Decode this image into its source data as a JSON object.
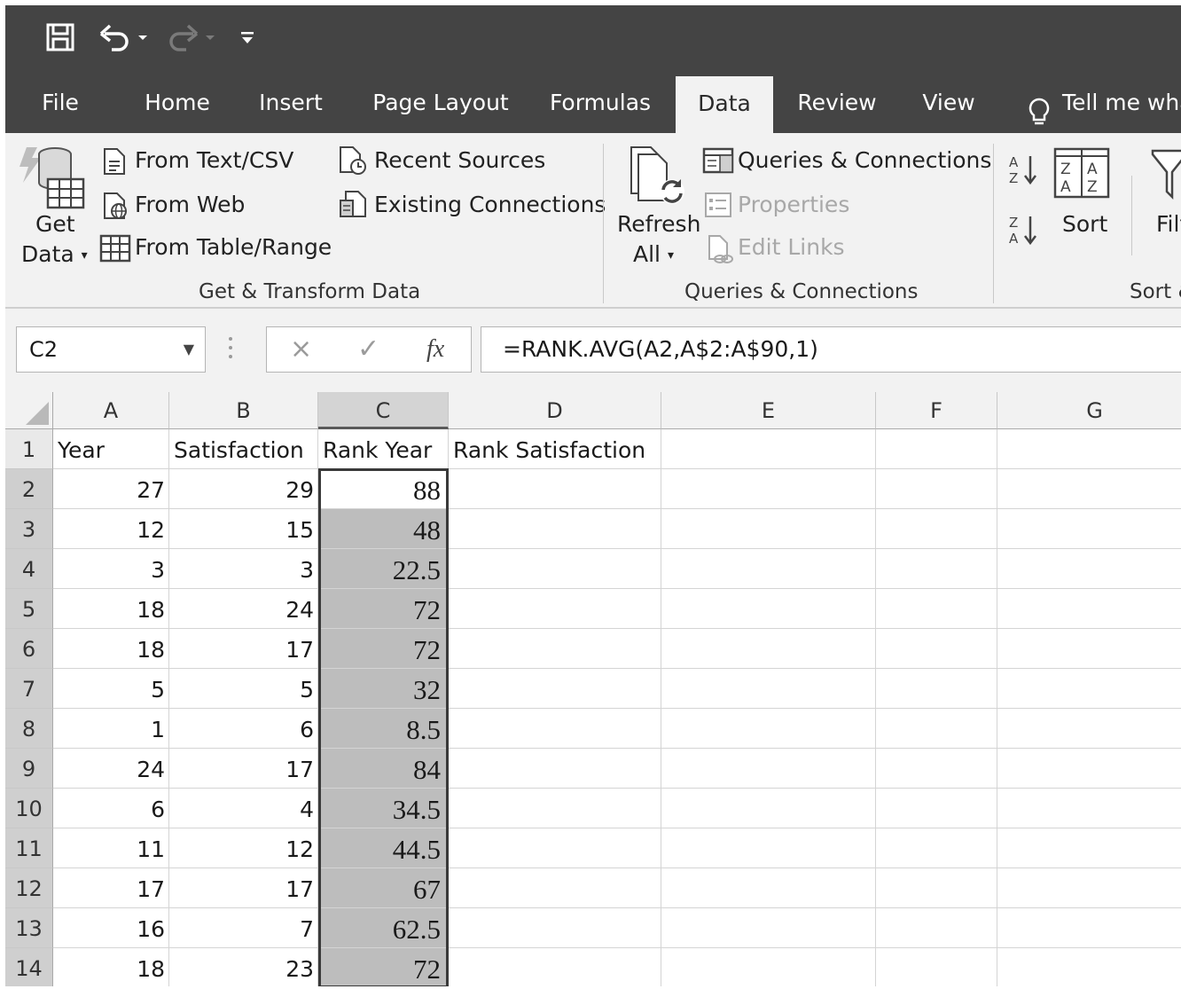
{
  "quick_access": {
    "save_icon": "save-icon",
    "undo_icon": "undo-icon",
    "redo_icon": "redo-icon",
    "customize_icon": "customize-qat-icon"
  },
  "tabs": [
    {
      "label": "File",
      "active": false
    },
    {
      "label": "Home",
      "active": false
    },
    {
      "label": "Insert",
      "active": false
    },
    {
      "label": "Page Layout",
      "active": false
    },
    {
      "label": "Formulas",
      "active": false
    },
    {
      "label": "Data",
      "active": true
    },
    {
      "label": "Review",
      "active": false
    },
    {
      "label": "View",
      "active": false
    }
  ],
  "tell_me": {
    "text": "Tell me wha",
    "icon": "lightbulb-icon"
  },
  "ribbon": {
    "get_transform": {
      "get_data_line1": "Get",
      "get_data_line2": "Data",
      "from_text_csv": "From Text/CSV",
      "from_web": "From Web",
      "from_table_range": "From Table/Range",
      "recent_sources": "Recent Sources",
      "existing_connections": "Existing Connections",
      "group_label": "Get & Transform Data"
    },
    "queries": {
      "refresh_line1": "Refresh",
      "refresh_line2": "All",
      "queries_connections": "Queries & Connections",
      "properties": "Properties",
      "edit_links": "Edit Links",
      "group_label": "Queries & Connections"
    },
    "sort_filter": {
      "sort": "Sort",
      "filter": "Filt",
      "group_label": "Sort &"
    }
  },
  "formula_bar": {
    "name_box": "C2",
    "cancel": "×",
    "enter": "✓",
    "fx": "fx",
    "formula": "=RANK.AVG(A2,A$2:A$90,1)"
  },
  "sheet": {
    "columns": [
      "A",
      "B",
      "C",
      "D",
      "E",
      "F",
      "G"
    ],
    "selected_column": "C",
    "header_row": {
      "a": "Year",
      "b": "Satisfaction",
      "c": "Rank Year",
      "d": "Rank Satisfaction"
    },
    "rows": [
      {
        "n": "1"
      },
      {
        "n": "2",
        "a": "27",
        "b": "29",
        "c": "88"
      },
      {
        "n": "3",
        "a": "12",
        "b": "15",
        "c": "48"
      },
      {
        "n": "4",
        "a": "3",
        "b": "3",
        "c": "22.5"
      },
      {
        "n": "5",
        "a": "18",
        "b": "24",
        "c": "72"
      },
      {
        "n": "6",
        "a": "18",
        "b": "17",
        "c": "72"
      },
      {
        "n": "7",
        "a": "5",
        "b": "5",
        "c": "32"
      },
      {
        "n": "8",
        "a": "1",
        "b": "6",
        "c": "8.5"
      },
      {
        "n": "9",
        "a": "24",
        "b": "17",
        "c": "84"
      },
      {
        "n": "10",
        "a": "6",
        "b": "4",
        "c": "34.5"
      },
      {
        "n": "11",
        "a": "11",
        "b": "12",
        "c": "44.5"
      },
      {
        "n": "12",
        "a": "17",
        "b": "17",
        "c": "67"
      },
      {
        "n": "13",
        "a": "16",
        "b": "7",
        "c": "62.5"
      },
      {
        "n": "14",
        "a": "18",
        "b": "23",
        "c": "72"
      }
    ]
  }
}
